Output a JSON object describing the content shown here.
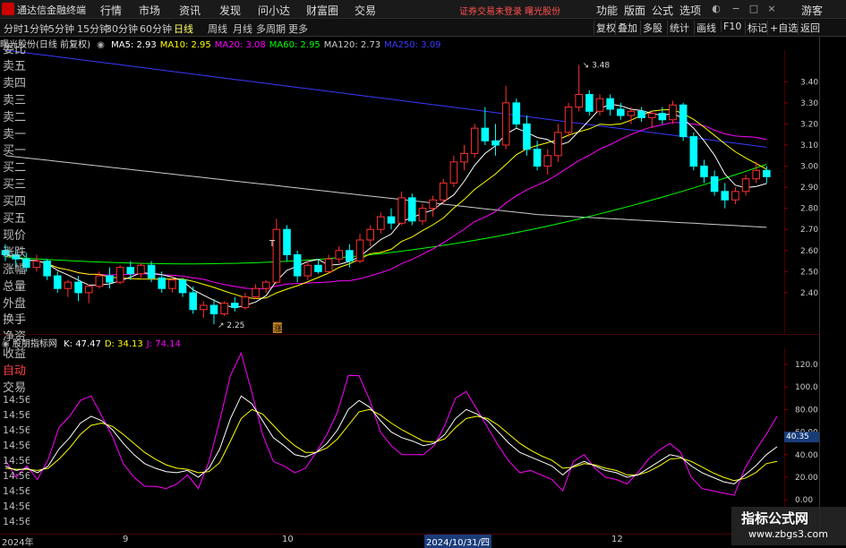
{
  "app": {
    "title": "通达信金融终端"
  },
  "menu": [
    "行情",
    "市场",
    "资讯",
    "发现",
    "问小达",
    "财富圈",
    "交易"
  ],
  "notice": "证券交易未登录   曙光股份",
  "right_menu": [
    "功能",
    "版面",
    "公式",
    "选项"
  ],
  "guest": "游客",
  "periods": [
    "分时",
    "1分钟",
    "5分钟",
    "15分钟",
    "30分钟",
    "60分钟",
    "日线",
    "周线",
    "月线",
    "多周期",
    "更多"
  ],
  "active_period": "日线",
  "toolbar_buttons": [
    "复权",
    "叠加",
    "多股",
    "统计",
    "画线",
    "F10",
    "标记",
    "+自选",
    "返回"
  ],
  "stock_label": "曙光股份(日线 前复权)",
  "ma": [
    {
      "label": "MA5: 2.93",
      "color": "#ffffff"
    },
    {
      "label": "MA10: 2.95",
      "color": "#ffff00"
    },
    {
      "label": "MA20: 3.08",
      "color": "#ff00ff"
    },
    {
      "label": "MA60: 2.95",
      "color": "#00ff00"
    },
    {
      "label": "MA120: 2.73",
      "color": "#cccccc"
    },
    {
      "label": "MA250: 3.09",
      "color": "#3a3aff"
    }
  ],
  "indicator": {
    "name": "股朋指标网",
    "values": [
      {
        "label": "K: 47.47",
        "color": "#ffffff"
      },
      {
        "label": "D: 34.13",
        "color": "#ffff00"
      },
      {
        "label": "J: 74.14",
        "color": "#ff00ff"
      }
    ]
  },
  "annotations": {
    "high": "3.48",
    "low": "2.25",
    "t_mark": "T",
    "badge": "涨"
  },
  "y_axis_main": [
    "3.40",
    "3.30",
    "3.20",
    "3.10",
    "3.00",
    "2.90",
    "2.80",
    "2.70",
    "2.60",
    "2.50",
    "2.40"
  ],
  "y_axis_ind": [
    "120.0",
    "100.0",
    "80.00",
    "60.00",
    "40.00",
    "20.00",
    "0.00"
  ],
  "current_ind_value": "40.35",
  "right_panel": [
    "委比",
    "卖五",
    "卖四",
    "卖三",
    "卖二",
    "卖一",
    "买一",
    "买二",
    "买三",
    "买四",
    "买五",
    "现价",
    "涨跌",
    "涨幅",
    "总量",
    "外盘",
    "换手",
    "净资",
    "收益",
    "自动",
    "交易",
    "14:56",
    "14:56",
    "14:56",
    "14:56",
    "14:56",
    "14:56",
    "14:56",
    "14:56",
    "14:56"
  ],
  "x_axis": [
    "2024年",
    "9",
    "10",
    "2024/10/31/四",
    "12"
  ],
  "watermark": {
    "line1": "指标公式网",
    "line2": "www.zbgs3.com"
  },
  "colors": {
    "up": "#ff3030",
    "down": "#00ffff",
    "ma5": "#ffffff",
    "ma10": "#ffff00",
    "ma20": "#ff00ff",
    "ma60": "#00ff00",
    "ma120": "#cccccc",
    "ma250": "#3a3aff"
  },
  "chart_data": {
    "type": "candlestick",
    "ylim": [
      2.2,
      3.55
    ],
    "candles": [
      [
        2.6,
        2.63,
        2.55,
        2.58
      ],
      [
        2.58,
        2.6,
        2.52,
        2.56
      ],
      [
        2.56,
        2.59,
        2.5,
        2.52
      ],
      [
        2.52,
        2.58,
        2.5,
        2.55
      ],
      [
        2.55,
        2.56,
        2.46,
        2.48
      ],
      [
        2.48,
        2.5,
        2.4,
        2.42
      ],
      [
        2.42,
        2.46,
        2.38,
        2.45
      ],
      [
        2.45,
        2.48,
        2.36,
        2.4
      ],
      [
        2.4,
        2.44,
        2.35,
        2.43
      ],
      [
        2.43,
        2.5,
        2.42,
        2.48
      ],
      [
        2.48,
        2.52,
        2.42,
        2.45
      ],
      [
        2.45,
        2.53,
        2.44,
        2.52
      ],
      [
        2.52,
        2.55,
        2.46,
        2.49
      ],
      [
        2.49,
        2.54,
        2.47,
        2.53
      ],
      [
        2.53,
        2.55,
        2.45,
        2.47
      ],
      [
        2.47,
        2.5,
        2.4,
        2.42
      ],
      [
        2.42,
        2.48,
        2.4,
        2.46
      ],
      [
        2.46,
        2.47,
        2.38,
        2.4
      ],
      [
        2.4,
        2.43,
        2.3,
        2.32
      ],
      [
        2.32,
        2.36,
        2.28,
        2.34
      ],
      [
        2.34,
        2.37,
        2.25,
        2.3
      ],
      [
        2.3,
        2.36,
        2.29,
        2.35
      ],
      [
        2.35,
        2.38,
        2.31,
        2.33
      ],
      [
        2.33,
        2.4,
        2.32,
        2.38
      ],
      [
        2.38,
        2.44,
        2.37,
        2.42
      ],
      [
        2.42,
        2.46,
        2.4,
        2.45
      ],
      [
        2.45,
        2.75,
        2.44,
        2.7
      ],
      [
        2.7,
        2.72,
        2.55,
        2.58
      ],
      [
        2.58,
        2.6,
        2.45,
        2.48
      ],
      [
        2.48,
        2.55,
        2.46,
        2.53
      ],
      [
        2.53,
        2.56,
        2.49,
        2.5
      ],
      [
        2.5,
        2.58,
        2.49,
        2.56
      ],
      [
        2.56,
        2.62,
        2.54,
        2.6
      ],
      [
        2.6,
        2.63,
        2.52,
        2.55
      ],
      [
        2.55,
        2.68,
        2.54,
        2.65
      ],
      [
        2.65,
        2.72,
        2.62,
        2.7
      ],
      [
        2.7,
        2.78,
        2.68,
        2.76
      ],
      [
        2.76,
        2.8,
        2.7,
        2.73
      ],
      [
        2.73,
        2.88,
        2.72,
        2.85
      ],
      [
        2.85,
        2.87,
        2.72,
        2.74
      ],
      [
        2.74,
        2.82,
        2.72,
        2.8
      ],
      [
        2.8,
        2.86,
        2.76,
        2.84
      ],
      [
        2.84,
        2.94,
        2.82,
        2.92
      ],
      [
        2.92,
        3.05,
        2.9,
        3.02
      ],
      [
        3.02,
        3.1,
        2.98,
        3.06
      ],
      [
        3.06,
        3.2,
        3.04,
        3.18
      ],
      [
        3.18,
        3.28,
        3.1,
        3.12
      ],
      [
        3.12,
        3.2,
        3.05,
        3.1
      ],
      [
        3.1,
        3.38,
        3.08,
        3.3
      ],
      [
        3.3,
        3.32,
        3.18,
        3.2
      ],
      [
        3.2,
        3.24,
        3.05,
        3.08
      ],
      [
        3.08,
        3.12,
        2.98,
        3.0
      ],
      [
        3.0,
        3.08,
        2.96,
        3.05
      ],
      [
        3.05,
        3.2,
        3.02,
        3.16
      ],
      [
        3.16,
        3.3,
        3.14,
        3.28
      ],
      [
        3.28,
        3.48,
        3.26,
        3.34
      ],
      [
        3.34,
        3.36,
        3.24,
        3.26
      ],
      [
        3.26,
        3.34,
        3.24,
        3.32
      ],
      [
        3.32,
        3.34,
        3.24,
        3.27
      ],
      [
        3.27,
        3.3,
        3.22,
        3.24
      ],
      [
        3.24,
        3.28,
        3.2,
        3.26
      ],
      [
        3.26,
        3.28,
        3.21,
        3.23
      ],
      [
        3.23,
        3.26,
        3.18,
        3.25
      ],
      [
        3.25,
        3.28,
        3.2,
        3.22
      ],
      [
        3.22,
        3.31,
        3.2,
        3.29
      ],
      [
        3.29,
        3.3,
        3.12,
        3.14
      ],
      [
        3.14,
        3.16,
        2.98,
        3.0
      ],
      [
        3.0,
        3.03,
        2.92,
        2.95
      ],
      [
        2.95,
        2.98,
        2.86,
        2.88
      ],
      [
        2.88,
        2.92,
        2.8,
        2.84
      ],
      [
        2.84,
        2.9,
        2.82,
        2.88
      ],
      [
        2.88,
        2.96,
        2.86,
        2.94
      ],
      [
        2.94,
        3.02,
        2.92,
        2.98
      ],
      [
        2.98,
        3.0,
        2.92,
        2.95
      ]
    ],
    "ma250_start": 3.55,
    "ma250_end": 3.09,
    "kdj": {
      "k": [
        30,
        26,
        28,
        24,
        30,
        45,
        55,
        68,
        74,
        70,
        62,
        50,
        40,
        32,
        28,
        25,
        24,
        26,
        20,
        28,
        45,
        72,
        92,
        85,
        70,
        55,
        48,
        40,
        38,
        42,
        50,
        62,
        80,
        88,
        82,
        70,
        60,
        55,
        52,
        48,
        50,
        58,
        72,
        80,
        76,
        70,
        60,
        50,
        42,
        38,
        34,
        30,
        22,
        30,
        34,
        30,
        26,
        24,
        20,
        22,
        28,
        34,
        40,
        38,
        30,
        24,
        20,
        16,
        14,
        22,
        30,
        40,
        47
      ],
      "d": [
        28,
        27,
        27,
        26,
        28,
        36,
        46,
        58,
        66,
        68,
        65,
        58,
        50,
        42,
        36,
        31,
        28,
        27,
        24,
        25,
        33,
        52,
        72,
        80,
        76,
        66,
        56,
        48,
        42,
        42,
        46,
        54,
        66,
        78,
        80,
        75,
        68,
        62,
        57,
        52,
        51,
        54,
        64,
        72,
        74,
        72,
        66,
        58,
        50,
        44,
        39,
        35,
        28,
        29,
        32,
        31,
        28,
        26,
        22,
        22,
        25,
        30,
        36,
        37,
        34,
        29,
        24,
        20,
        17,
        19,
        24,
        32,
        34
      ],
      "j": [
        35,
        20,
        30,
        18,
        36,
        64,
        74,
        88,
        92,
        74,
        56,
        32,
        20,
        12,
        12,
        10,
        14,
        22,
        10,
        34,
        70,
        110,
        130,
        95,
        58,
        34,
        30,
        24,
        28,
        42,
        58,
        78,
        110,
        110,
        88,
        60,
        48,
        40,
        40,
        40,
        48,
        66,
        90,
        96,
        80,
        64,
        48,
        34,
        24,
        26,
        22,
        18,
        8,
        34,
        40,
        28,
        20,
        18,
        14,
        24,
        36,
        44,
        50,
        42,
        20,
        10,
        8,
        6,
        4,
        28,
        44,
        58,
        74
      ]
    }
  }
}
